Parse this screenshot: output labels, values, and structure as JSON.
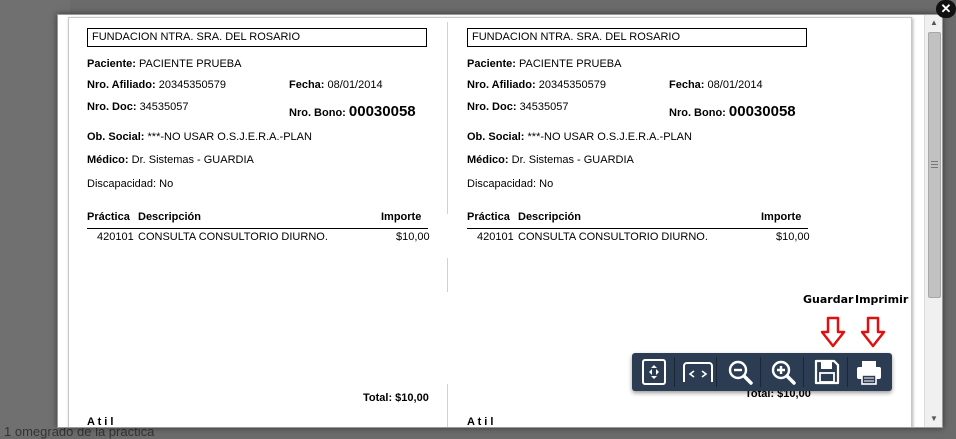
{
  "background": {
    "text": "1 omegrado de la práctica"
  },
  "document": {
    "columns": [
      {
        "institution": "FUNDACION NTRA. SRA. DEL ROSARIO",
        "paciente_label": "Paciente:",
        "paciente_value": "PACIENTE PRUEBA",
        "afiliado_label": "Nro. Afiliado:",
        "afiliado_value": "20345350579",
        "fecha_label": "Fecha:",
        "fecha_value": "08/01/2014",
        "doc_label": "Nro. Doc:",
        "doc_value": "34535057",
        "bono_label": "Nro. Bono:",
        "bono_value": "00030058",
        "obsocial_label": "Ob. Social:",
        "obsocial_value": "***-NO USAR O.S.J.E.R.A.-PLAN",
        "medico_label": "Médico:",
        "medico_value": "Dr. Sistemas - GUARDIA",
        "discapacidad_label": "Discapacidad:",
        "discapacidad_value": "No",
        "table_headers": {
          "practica": "Práctica",
          "descripcion": "Descripción",
          "importe": "Importe"
        },
        "table_rows": [
          {
            "practica": "420101",
            "descripcion": "CONSULTA CONSULTORIO  DIURNO.",
            "importe": "$10,00"
          }
        ],
        "total": "Total: $10,00",
        "footer_cut": "A t  i  l"
      },
      {
        "institution": "FUNDACION NTRA. SRA. DEL ROSARIO",
        "paciente_label": "Paciente:",
        "paciente_value": "PACIENTE PRUEBA",
        "afiliado_label": "Nro. Afiliado:",
        "afiliado_value": "20345350579",
        "fecha_label": "Fecha:",
        "fecha_value": "08/01/2014",
        "doc_label": "Nro. Doc:",
        "doc_value": "34535057",
        "bono_label": "Nro. Bono:",
        "bono_value": "00030058",
        "obsocial_label": "Ob. Social:",
        "obsocial_value": "***-NO USAR O.S.J.E.R.A.-PLAN",
        "medico_label": "Médico:",
        "medico_value": "Dr. Sistemas - GUARDIA",
        "discapacidad_label": "Discapacidad:",
        "discapacidad_value": "No",
        "table_headers": {
          "practica": "Práctica",
          "descripcion": "Descripción",
          "importe": "Importe"
        },
        "table_rows": [
          {
            "practica": "420101",
            "descripcion": "CONSULTA CONSULTORIO  DIURNO.",
            "importe": "$10,00"
          }
        ],
        "total": "Total: $10,00",
        "footer_cut": "A t  i  l"
      }
    ]
  },
  "toolbar": {
    "buttons": [
      {
        "name": "fit-page",
        "icon": "fit-page-icon"
      },
      {
        "name": "fit-width",
        "icon": "fit-width-icon"
      },
      {
        "name": "zoom-out",
        "icon": "zoom-out-icon"
      },
      {
        "name": "zoom-in",
        "icon": "zoom-in-icon"
      },
      {
        "name": "save",
        "icon": "floppy-disk-icon"
      },
      {
        "name": "print",
        "icon": "printer-icon"
      }
    ]
  },
  "annotations": {
    "guardar": "Guardar",
    "imprimir": "Imprimir",
    "arrow_color": "#e01010"
  },
  "close_button": {
    "icon": "close-icon",
    "glyph": "✕"
  }
}
